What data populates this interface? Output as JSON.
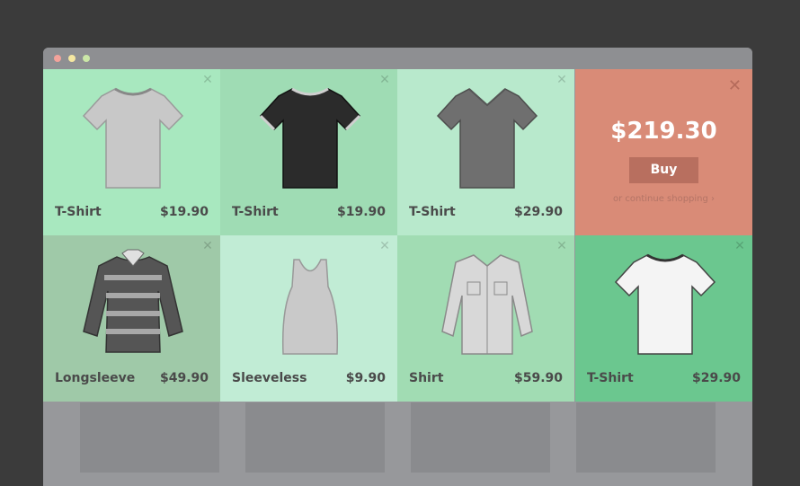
{
  "window": {
    "controls": [
      "close",
      "minimize",
      "zoom"
    ]
  },
  "products": [
    {
      "name": "T-Shirt",
      "price": "$19.90",
      "color": "#a8e8bf",
      "icon": "grey-tshirt-icon"
    },
    {
      "name": "T-Shirt",
      "price": "$19.90",
      "color": "#9fdcb4",
      "icon": "black-tshirt-icon"
    },
    {
      "name": "T-Shirt",
      "price": "$29.90",
      "color": "#b8e9cc",
      "icon": "darkgrey-tshirt-icon"
    },
    {
      "name": "Longsleeve",
      "price": "$49.90",
      "color": "#9fc9a8",
      "icon": "striped-longsleeve-icon"
    },
    {
      "name": "Sleeveless",
      "price": "$9.90",
      "color": "#c1ecd5",
      "icon": "tank-top-icon"
    },
    {
      "name": "Shirt",
      "price": "$59.90",
      "color": "#a1dcb3",
      "icon": "button-shirt-icon"
    },
    {
      "name": "T-Shirt",
      "price": "$29.90",
      "color": "#6bc78f",
      "icon": "white-tshirt-icon"
    }
  ],
  "checkout": {
    "total": "$219.30",
    "buy_label": "Buy",
    "continue_label": "or continue shopping ›",
    "color": "#d98b77"
  }
}
